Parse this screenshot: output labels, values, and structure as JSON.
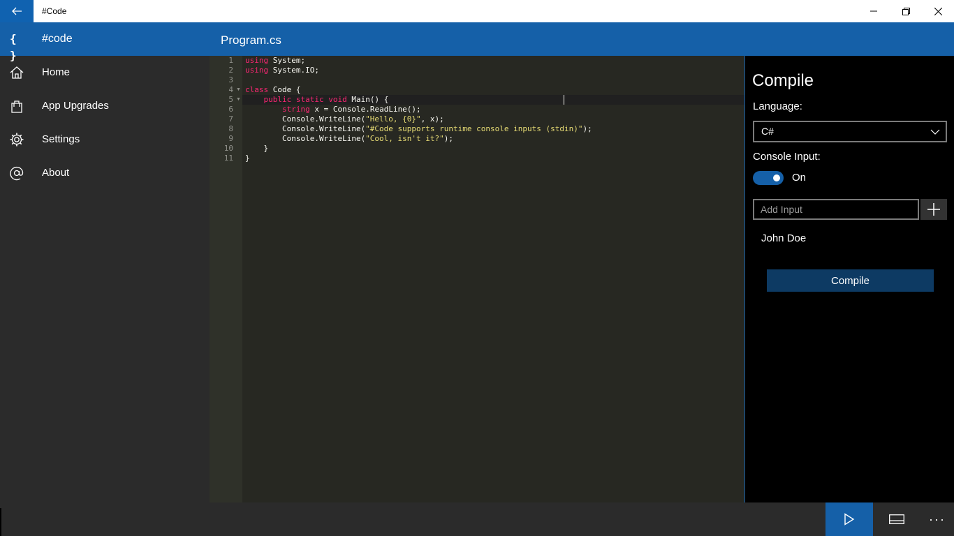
{
  "titlebar": {
    "title": "#Code"
  },
  "sidebar": {
    "brand_icon": "{ }",
    "brand_label": "#code",
    "items": [
      {
        "label": "Home",
        "icon": "home-icon"
      },
      {
        "label": "App Upgrades",
        "icon": "shopping-bag-icon"
      },
      {
        "label": "Settings",
        "icon": "gear-icon"
      },
      {
        "label": "About",
        "icon": "at-sign-icon"
      }
    ]
  },
  "editor": {
    "file_name": "Program.cs",
    "line_numbers": [
      "1",
      "2",
      "3",
      "4",
      "5",
      "6",
      "7",
      "8",
      "9",
      "10",
      "11"
    ],
    "code": {
      "l1_kw": "using",
      "l1_rest": " System;",
      "l2_kw": "using",
      "l2_rest": " System.IO;",
      "l4_kw": "class",
      "l4_rest": " Code {",
      "l5_indent": "    ",
      "l5_kw": "public static void",
      "l5_rest": " Main() {",
      "l6_indent": "        ",
      "l6_kw": "string",
      "l6_rest": " x = Console.ReadLine();",
      "l7_pre": "        Console.WriteLine(",
      "l7_str": "\"Hello, {0}\"",
      "l7_post": ", x);",
      "l8_pre": "        Console.WriteLine(",
      "l8_str": "\"#Code supports runtime console inputs (stdin)\"",
      "l8_post": ");",
      "l9_pre": "        Console.WriteLine(",
      "l9_str": "\"Cool, isn't it?\"",
      "l9_post": ");",
      "l10": "    }",
      "l11": "}"
    }
  },
  "compile_panel": {
    "title": "Compile",
    "language_label": "Language:",
    "language_value": "C#",
    "console_input_label": "Console Input:",
    "toggle_state": "On",
    "input_placeholder": "Add Input",
    "inputs": [
      "John Doe"
    ],
    "compile_button": "Compile"
  },
  "colors": {
    "accent": "#1560a8",
    "keyword": "#f92672",
    "string": "#e6db74",
    "editor_bg": "#272822"
  }
}
